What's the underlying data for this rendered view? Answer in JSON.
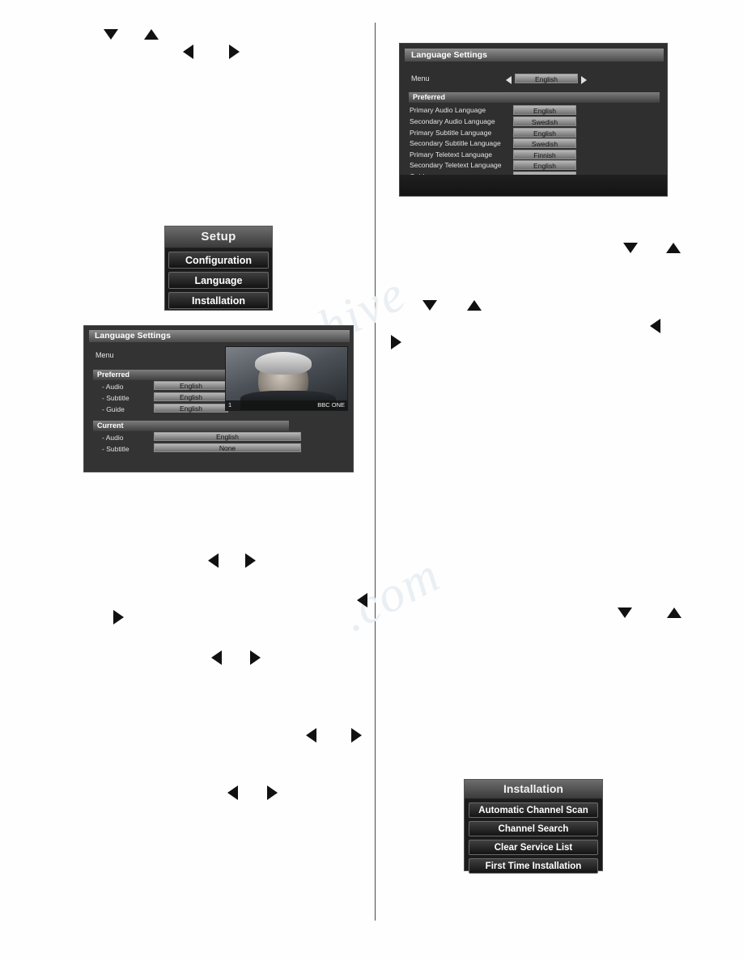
{
  "page": {
    "watermark_line1": "manualshive",
    "watermark_line2": ".com"
  },
  "setup_menu": {
    "title": "Setup",
    "items": [
      {
        "label": "Configuration"
      },
      {
        "label": "Language"
      },
      {
        "label": "Installation"
      }
    ]
  },
  "installation_menu": {
    "title": "Installation",
    "items": [
      {
        "label": "Automatic Channel Scan"
      },
      {
        "label": "Channel Search"
      },
      {
        "label": "Clear Service List"
      },
      {
        "label": "First Time Installation"
      }
    ]
  },
  "language_settings_left": {
    "title": "Language Settings",
    "menu_row": {
      "label": "Menu",
      "value": "English"
    },
    "preferred": {
      "section_label": "Preferred",
      "rows": [
        {
          "label": "- Audio",
          "value": "English"
        },
        {
          "label": "- Subtitle",
          "value": "English"
        },
        {
          "label": "- Guide",
          "value": "English"
        }
      ]
    },
    "current": {
      "section_label": "Current",
      "rows": [
        {
          "label": "- Audio",
          "value": "English"
        },
        {
          "label": "- Subtitle",
          "value": "None"
        }
      ]
    },
    "preview": {
      "channel_number": "1",
      "channel_name": "BBC ONE"
    }
  },
  "language_settings_right": {
    "title": "Language Settings",
    "menu_row": {
      "label": "Menu",
      "value": "English"
    },
    "preferred_section_label": "Preferred",
    "rows": [
      {
        "label": "Primary Audio Language",
        "value": "English"
      },
      {
        "label": "Secondary Audio Language",
        "value": "Swedish"
      },
      {
        "label": "Primary Subtitle Language",
        "value": "English"
      },
      {
        "label": "Secondary Subtitle Language",
        "value": "Swedish"
      },
      {
        "label": "Primary Teletext Language",
        "value": "Finnish"
      },
      {
        "label": "Secondary Teletext Language",
        "value": "English"
      },
      {
        "label": "Guide",
        "value": "Finnish"
      }
    ]
  },
  "arrows": {
    "down": "down-arrow-icon",
    "up": "up-arrow-icon",
    "left": "left-arrow-icon",
    "right": "right-arrow-icon"
  }
}
